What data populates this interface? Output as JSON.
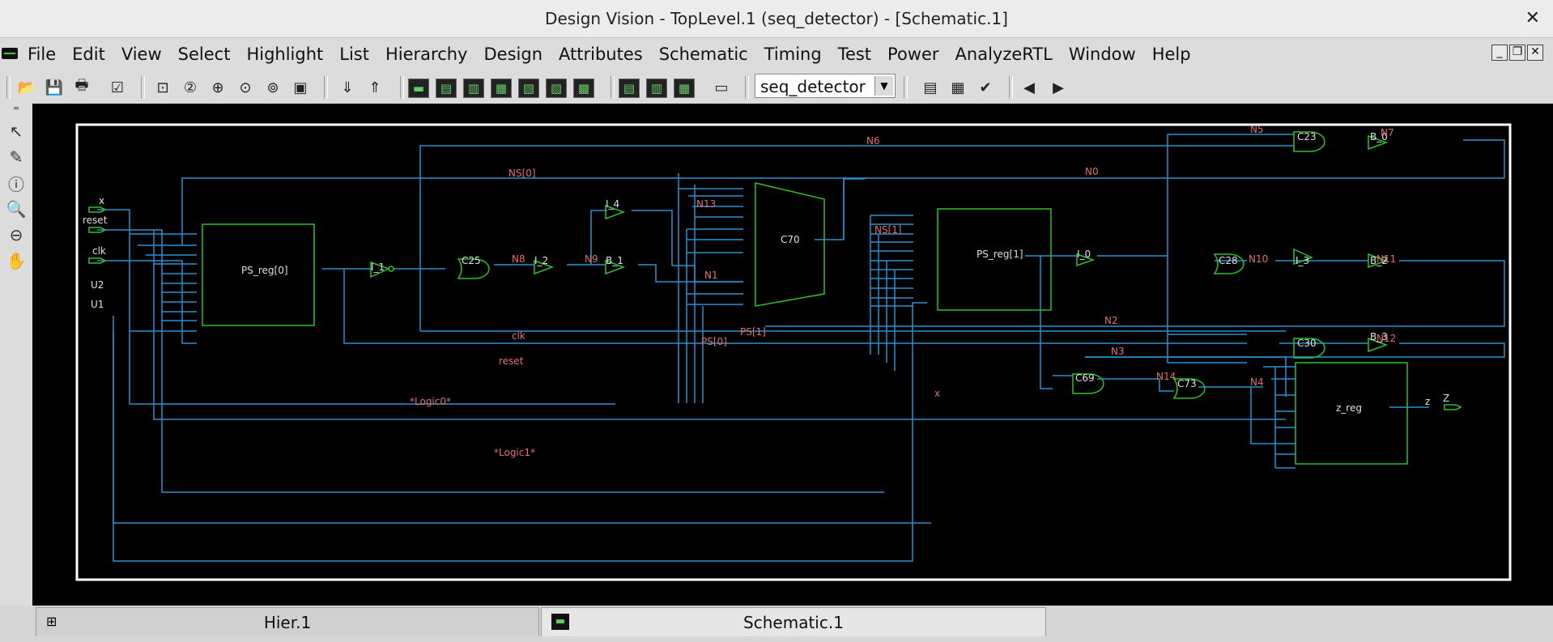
{
  "window": {
    "title": "Design Vision - TopLevel.1 (seq_detector) - [Schematic.1]",
    "close": "✕"
  },
  "menu": [
    "File",
    "Edit",
    "View",
    "Select",
    "Highlight",
    "List",
    "Hierarchy",
    "Design",
    "Attributes",
    "Schematic",
    "Timing",
    "Test",
    "Power",
    "AnalyzeRTL",
    "Window",
    "Help"
  ],
  "window_controls": [
    "_",
    "❐",
    "✕"
  ],
  "toolbar": {
    "design_select": "seq_detector"
  },
  "schematic": {
    "ports": [
      "x",
      "reset",
      "clk",
      "U2",
      "U1",
      "z",
      "Z"
    ],
    "cells": {
      "ps_reg0": "PS_reg[0]",
      "ps_reg1": "PS_reg[1]",
      "z_reg": "z_reg",
      "c70": "C70",
      "c25": "C25",
      "c23": "C23",
      "c28": "C28",
      "c30": "C30",
      "c69": "C69",
      "c73": "C73",
      "i1": "I_1",
      "i2": "I_2",
      "i4": "I_4",
      "i0": "I_0",
      "i3": "I_3",
      "b0": "B_0",
      "b1": "B_1",
      "b2": "B_2",
      "b3": "B_3"
    },
    "nets": {
      "n6": "N6",
      "n5": "N5",
      "n7": "N7",
      "n0": "N0",
      "ns0": "NS[0]",
      "n13": "N13",
      "ns1": "NS[1]",
      "n8": "N8",
      "n9": "N9",
      "n1": "N1",
      "n10": "N10",
      "n11": "N11",
      "ps1": "PS[1]",
      "n2": "N2",
      "clk": "clk",
      "ps0": "PS[0]",
      "n12": "N12",
      "n3": "N3",
      "reset": "reset",
      "n14": "N14",
      "n4": "N4",
      "logic0": "*Logic0*",
      "x": "x",
      "logic1": "*Logic1*"
    }
  },
  "tabs": [
    {
      "label": "Hier.1"
    },
    {
      "label": "Schematic.1"
    }
  ]
}
